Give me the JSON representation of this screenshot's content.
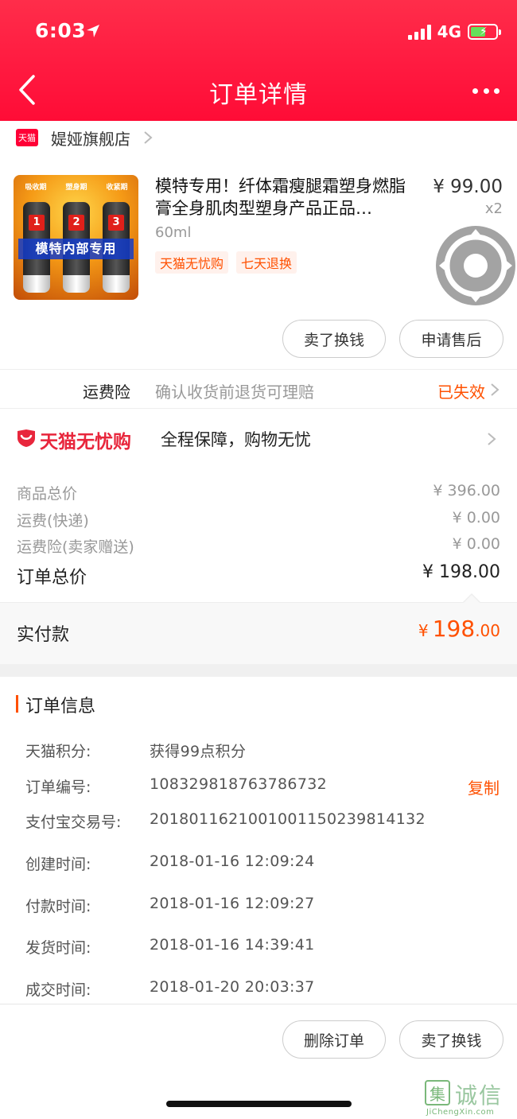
{
  "status_bar": {
    "time": "6:03",
    "network": "4G"
  },
  "nav": {
    "title": "订单详情"
  },
  "shop": {
    "badge": "天猫",
    "name": "媞娅旗舰店"
  },
  "product": {
    "title": "模特专用！纤体霜瘦腿霜塑身燃脂膏全身肌肉型塑身产品正品…",
    "spec": "60ml",
    "tags": [
      "天猫无忧购",
      "七天退换"
    ],
    "price": "¥ 99.00",
    "qty": "x2",
    "image_text": {
      "phases": [
        "吸收期",
        "塑身期",
        "收紧期"
      ],
      "numbers": [
        "1",
        "2",
        "3"
      ],
      "banner": "模特内部专用"
    }
  },
  "product_actions": {
    "sell": "卖了换钱",
    "after_sale": "申请售后"
  },
  "insurance": {
    "label": "运费险",
    "desc": "确认收货前退货可理赔",
    "status": "已失效"
  },
  "guarantee": {
    "logo_text": "天猫无忧购",
    "desc": "全程保障，购物无忧"
  },
  "summary": {
    "items": [
      {
        "label": "商品总价",
        "value": "¥ 396.00"
      },
      {
        "label": "运费(快递)",
        "value": "¥ 0.00"
      },
      {
        "label": "运费险(卖家赠送)",
        "value": "¥ 0.00"
      }
    ],
    "total_label": "订单总价",
    "total_value": "¥ 198.00",
    "paid_label": "实付款",
    "paid_currency": "¥",
    "paid_int": "198",
    "paid_dec": ".00"
  },
  "order_info": {
    "title": "订单信息",
    "copy_label": "复制",
    "rows": [
      {
        "label": "天猫积分:",
        "value": "获得99点积分"
      },
      {
        "label": "订单编号:",
        "value": "108329818763786732"
      },
      {
        "label": "支付宝交易号:",
        "value": "2018011621001001150239814132"
      },
      {
        "label": "创建时间:",
        "value": "2018-01-16 12:09:24"
      },
      {
        "label": "付款时间:",
        "value": "2018-01-16 12:09:27"
      },
      {
        "label": "发货时间:",
        "value": "2018-01-16 14:39:41"
      },
      {
        "label": "成交时间:",
        "value": "2018-01-20 20:03:37"
      }
    ]
  },
  "bottom_actions": {
    "delete": "删除订单",
    "sell": "卖了换钱"
  },
  "watermark": {
    "char": "集",
    "text": "诚信",
    "url": "JiChengXin.com"
  },
  "colors": {
    "brand_red": "#ff0036",
    "accent_orange": "#ff5000"
  }
}
